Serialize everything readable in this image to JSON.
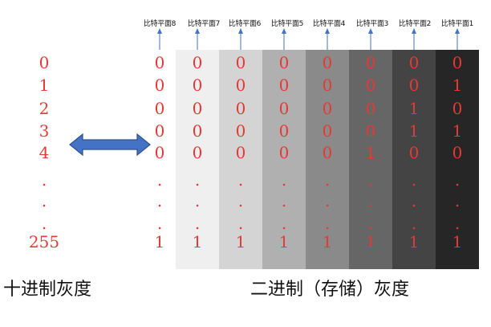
{
  "plane_labels": [
    "比特平面8",
    "比特平面7",
    "比特平面6",
    "比特平面5",
    "比特平面4",
    "比特平面3",
    "比特平面2",
    "比特平面1"
  ],
  "decimal_values": [
    "0",
    "1",
    "2",
    "3",
    "4",
    ".",
    ".",
    ".",
    "255"
  ],
  "bit_rows": [
    [
      "0",
      "0",
      "0",
      "0",
      "0",
      "0",
      "0",
      "0"
    ],
    [
      "0",
      "0",
      "0",
      "0",
      "0",
      "0",
      "0",
      "1"
    ],
    [
      "0",
      "0",
      "0",
      "0",
      "0",
      "0",
      "1",
      "0"
    ],
    [
      "0",
      "0",
      "0",
      "0",
      "0",
      "0",
      "1",
      "1"
    ],
    [
      "0",
      "0",
      "0",
      "0",
      "0",
      "1",
      "0",
      "0"
    ],
    [
      ".",
      ".",
      ".",
      ".",
      ".",
      ".",
      ".",
      "."
    ],
    [
      ".",
      ".",
      ".",
      ".",
      ".",
      ".",
      ".",
      "."
    ],
    [
      ".",
      ".",
      ".",
      ".",
      ".",
      ".",
      ".",
      "."
    ],
    [
      "1",
      "1",
      "1",
      "1",
      "1",
      "1",
      "1",
      "1"
    ]
  ],
  "column_shades": [
    "#ffffff",
    "#efefef",
    "#d4d4d4",
    "#b0b0b0",
    "#8a8a8a",
    "#666666",
    "#444444",
    "#262626"
  ],
  "captions": {
    "decimal": "十进制灰度",
    "binary": "二进制（存储）灰度"
  },
  "colors": {
    "digit": "#e53935",
    "arrow": "#4472c4",
    "arrow_stroke": "#2f528f"
  }
}
